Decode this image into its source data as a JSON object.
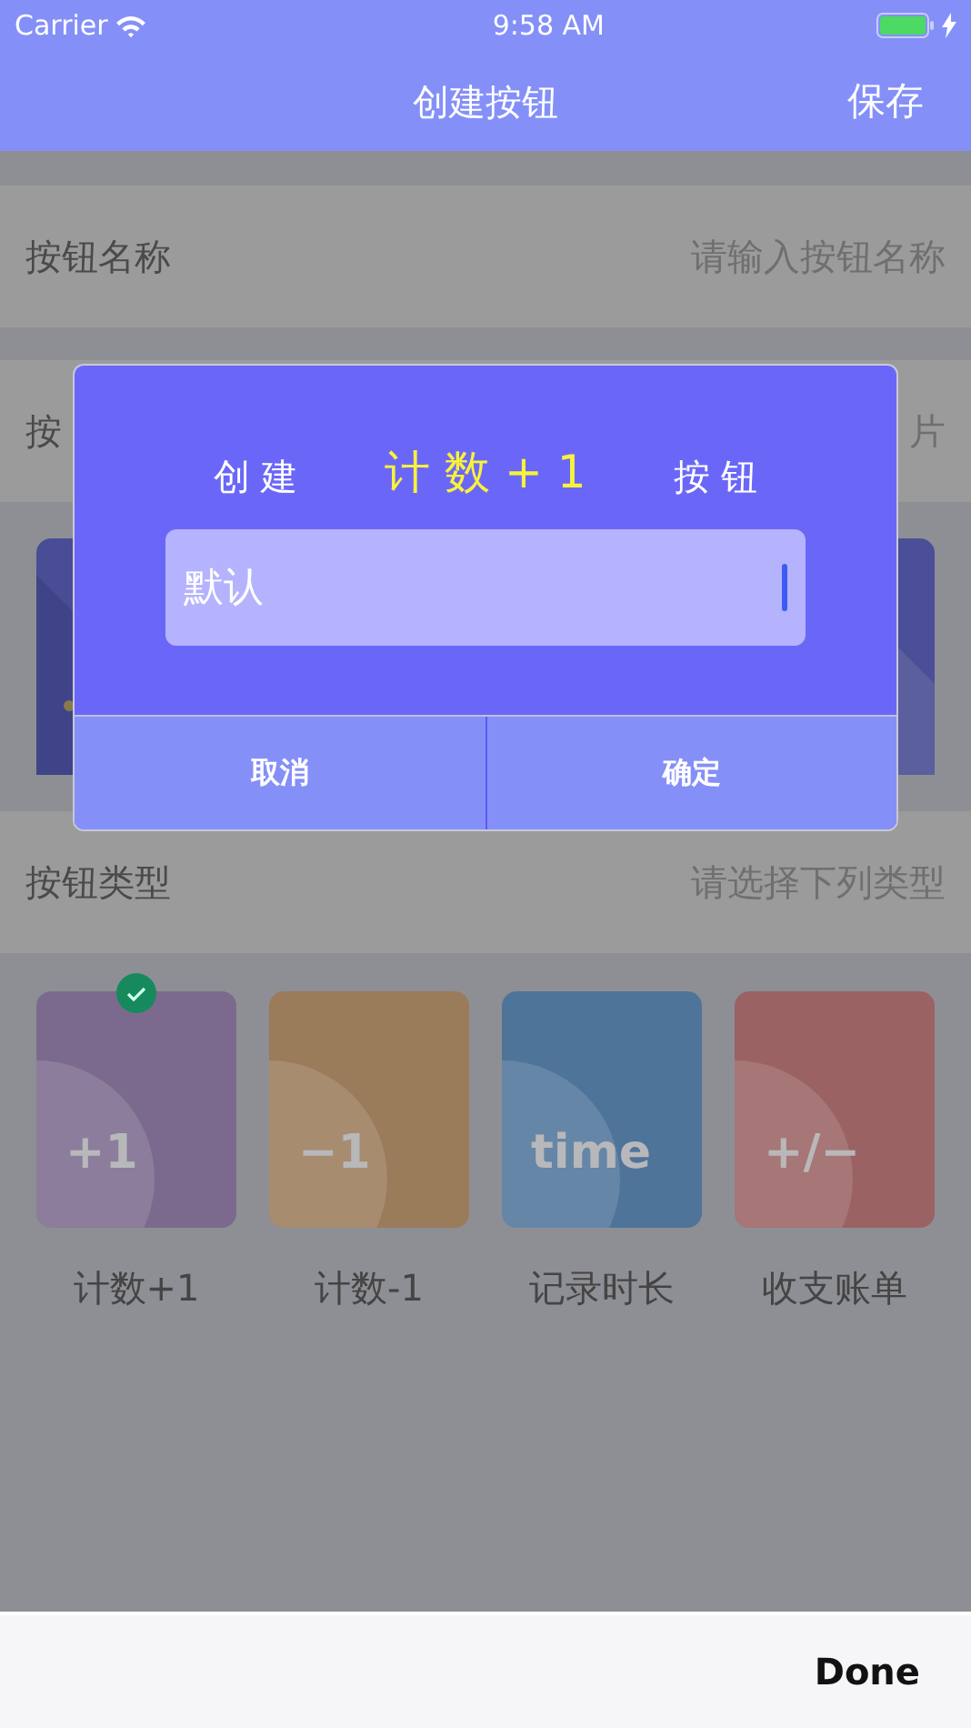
{
  "status_bar": {
    "carrier": "Carrier",
    "time": "9:58 AM"
  },
  "nav": {
    "title": "创建按钮",
    "action": "保存"
  },
  "form_rows": [
    {
      "label": "按钮名称",
      "placeholder": "请输入按钮名称"
    },
    {
      "label": "按",
      "placeholder": "片"
    }
  ],
  "type_row": {
    "label": "按钮类型",
    "placeholder": "请选择下列类型"
  },
  "types": [
    {
      "glyph": "+1",
      "label": "计数+1",
      "color": "#7b6a8e",
      "selected": true
    },
    {
      "glyph": "−1",
      "label": "计数-1",
      "color": "#9a7b5a",
      "selected": false
    },
    {
      "glyph": "time",
      "label": "记录时长",
      "color": "#4f7499",
      "selected": false
    },
    {
      "glyph": "+/−",
      "label": "收支账单",
      "color": "#9a6263",
      "selected": false
    }
  ],
  "dialog": {
    "title_prefix": "创 建",
    "title_name": "计 数 + 1",
    "title_suffix": "按 钮",
    "field_value": "默认",
    "buttons": [
      "取消",
      "确定"
    ]
  },
  "keyboard_toolbar": {
    "done": "Done"
  }
}
